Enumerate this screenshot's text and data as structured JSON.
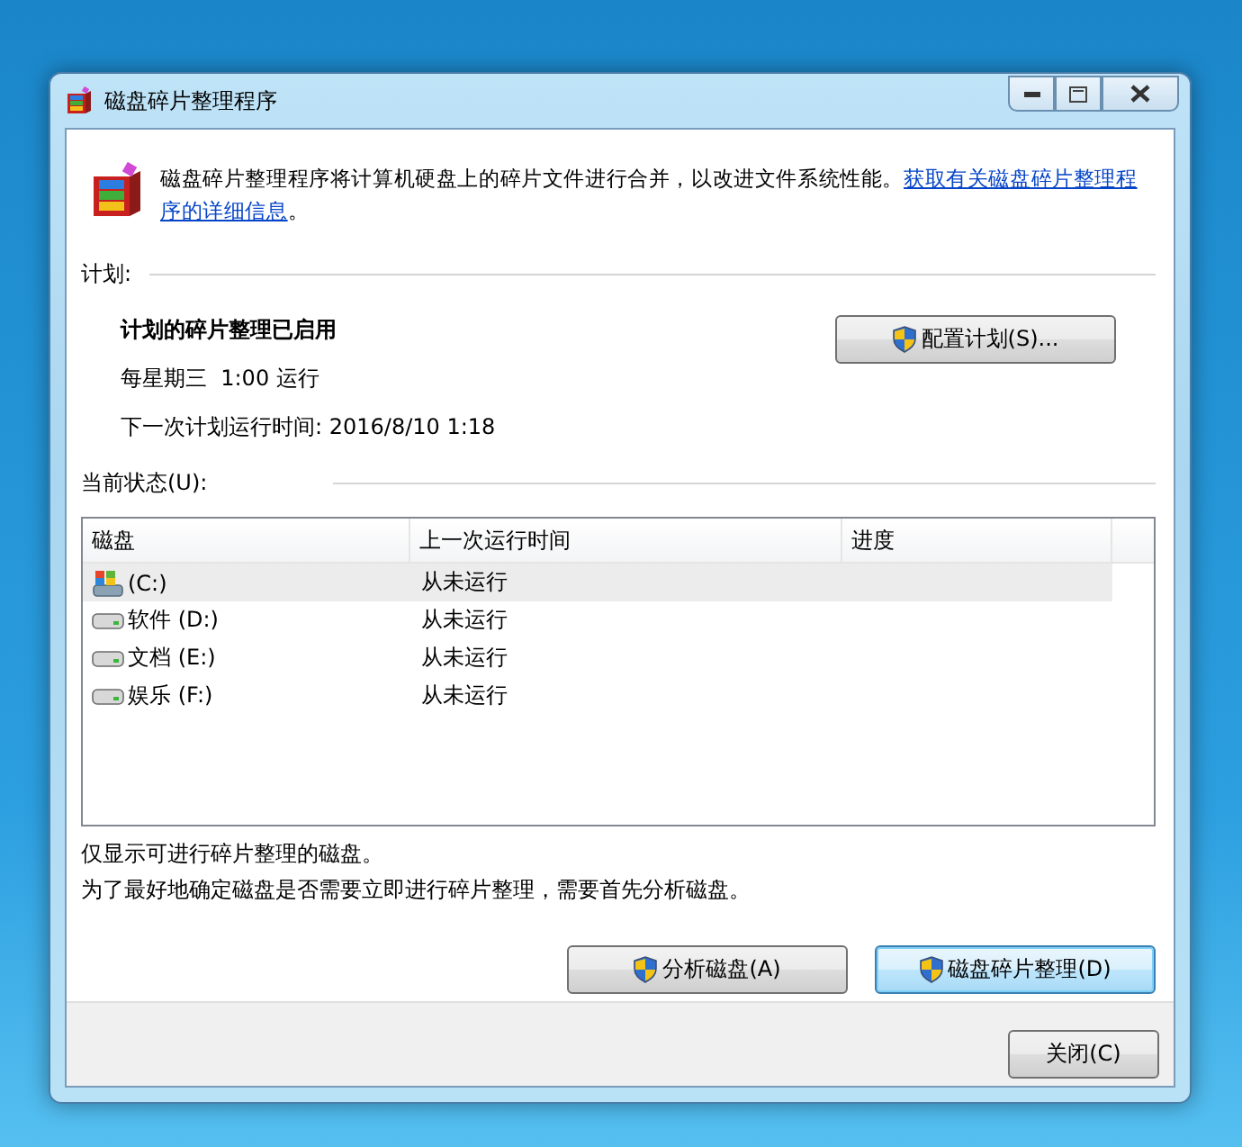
{
  "window": {
    "title": "磁盘碎片整理程序",
    "controls": [
      {
        "kind": "minimize"
      },
      {
        "kind": "maximize"
      },
      {
        "kind": "close"
      }
    ]
  },
  "intro": {
    "text": "磁盘碎片整理程序将计算机硬盘上的碎片文件进行合并，以改进文件系统性能。",
    "link": [
      "获取有关磁盘碎片整理程",
      "序的详细信息"
    ],
    "tail": "。"
  },
  "schedule": {
    "heading": "计划:",
    "status": "计划的碎片整理已启用",
    "frequency": "每星期三  1:00 运行",
    "next_run": "下一次计划运行时间: 2016/8/10 1:18",
    "button": "配置计划(S)..."
  },
  "current_status": {
    "heading": "当前状态(U):",
    "columns": [
      "磁盘",
      "上一次运行时间",
      "进度"
    ],
    "rows": [
      {
        "disk": "(C:)",
        "last_run": "从未运行",
        "kind": "system",
        "selected": true
      },
      {
        "disk": "软件 (D:)",
        "last_run": "从未运行",
        "kind": "drive",
        "selected": false
      },
      {
        "disk": "文档 (E:)",
        "last_run": "从未运行",
        "kind": "drive",
        "selected": false
      },
      {
        "disk": "娱乐 (F:)",
        "last_run": "从未运行",
        "kind": "drive",
        "selected": false
      }
    ]
  },
  "notes": [
    "仅显示可进行碎片整理的磁盘。",
    "为了最好地确定磁盘是否需要立即进行碎片整理，需要首先分析磁盘。"
  ],
  "actions": [
    {
      "label": "分析磁盘(A)",
      "default": false
    },
    {
      "label": "磁盘碎片整理(D)",
      "default": true
    }
  ],
  "close_button": "关闭(C)"
}
